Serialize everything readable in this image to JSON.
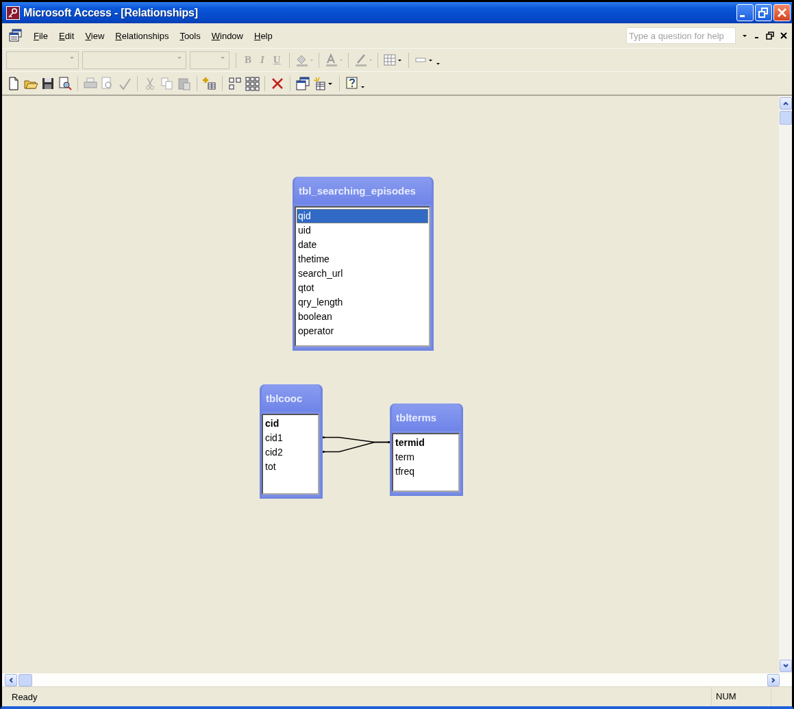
{
  "window": {
    "title": "Microsoft Access - [Relationships]"
  },
  "menu": [
    "File",
    "Edit",
    "View",
    "Relationships",
    "Tools",
    "Window",
    "Help"
  ],
  "help_box": {
    "placeholder": "Type a question for help"
  },
  "formatting_buttons": [
    {
      "label": "B",
      "disabled": true
    },
    {
      "label": "I",
      "disabled": true
    },
    {
      "label": "U",
      "disabled": true
    }
  ],
  "tables": [
    {
      "name": "tbl_searching_episodes",
      "fields": [
        {
          "name": "qid",
          "primary_key": false,
          "selected": true
        },
        {
          "name": "uid",
          "primary_key": false,
          "selected": false
        },
        {
          "name": "date",
          "primary_key": false,
          "selected": false
        },
        {
          "name": "thetime",
          "primary_key": false,
          "selected": false
        },
        {
          "name": "search_url",
          "primary_key": false,
          "selected": false
        },
        {
          "name": "qtot",
          "primary_key": false,
          "selected": false
        },
        {
          "name": "qry_length",
          "primary_key": false,
          "selected": false
        },
        {
          "name": "boolean",
          "primary_key": false,
          "selected": false
        },
        {
          "name": "operator",
          "primary_key": false,
          "selected": false
        }
      ]
    },
    {
      "name": "tblcooc",
      "fields": [
        {
          "name": "cid",
          "primary_key": true,
          "selected": false,
          "joined": false
        },
        {
          "name": "cid1",
          "primary_key": false,
          "selected": false,
          "joined": true
        },
        {
          "name": "cid2",
          "primary_key": false,
          "selected": false,
          "joined": true
        },
        {
          "name": "tot",
          "primary_key": false,
          "selected": false
        }
      ]
    },
    {
      "name": "tblterms",
      "fields": [
        {
          "name": "termid",
          "primary_key": true,
          "selected": false,
          "joined": true
        },
        {
          "name": "term",
          "primary_key": false,
          "selected": false
        },
        {
          "name": "tfreq",
          "primary_key": false,
          "selected": false
        }
      ]
    }
  ],
  "status_bar": {
    "text": "Ready",
    "indicators": [
      "NUM"
    ]
  }
}
